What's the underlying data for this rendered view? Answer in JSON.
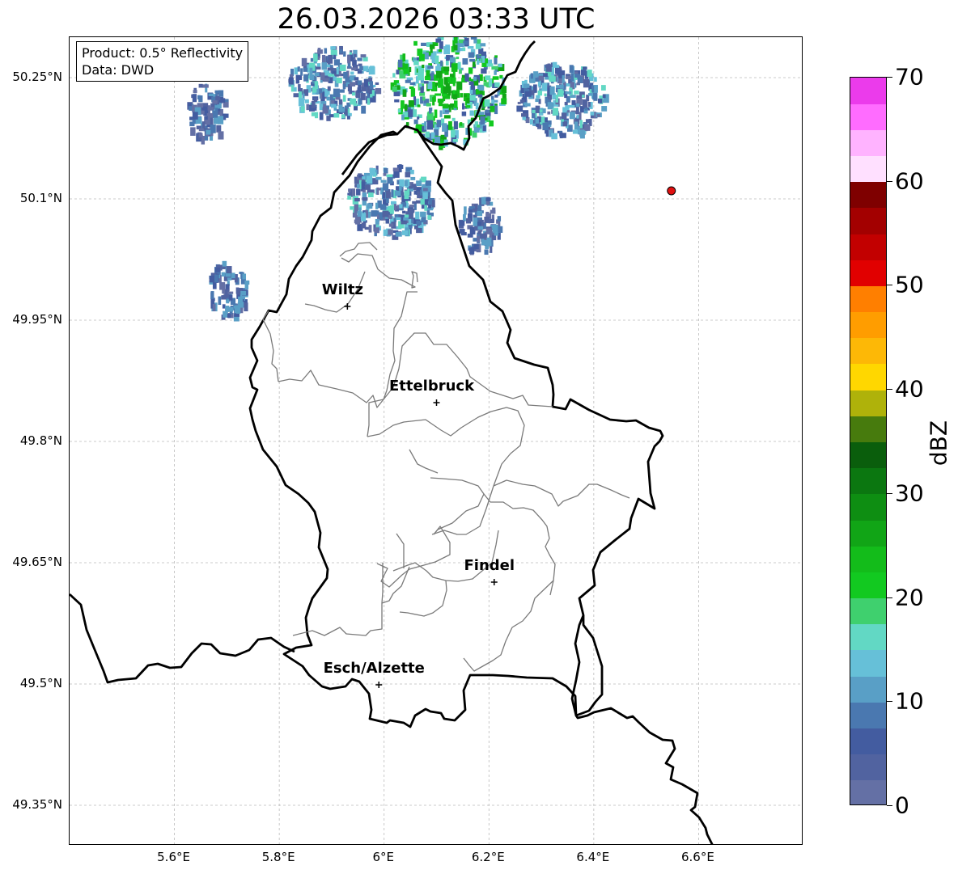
{
  "title": "26.03.2026 03:33 UTC",
  "infobox": {
    "product": "Product: 0.5° Reflectivity",
    "data": "Data: DWD"
  },
  "lat_ticks": [
    {
      "value": 50.25,
      "label": "50.25°N"
    },
    {
      "value": 50.1,
      "label": "50.1°N"
    },
    {
      "value": 49.95,
      "label": "49.95°N"
    },
    {
      "value": 49.8,
      "label": "49.8°N"
    },
    {
      "value": 49.65,
      "label": "49.65°N"
    },
    {
      "value": 49.5,
      "label": "49.5°N"
    },
    {
      "value": 49.35,
      "label": "49.35°N"
    }
  ],
  "lon_ticks": [
    {
      "value": 5.6,
      "label": "5.6°E"
    },
    {
      "value": 5.8,
      "label": "5.8°E"
    },
    {
      "value": 6.0,
      "label": "6°E"
    },
    {
      "value": 6.2,
      "label": "6.2°E"
    },
    {
      "value": 6.4,
      "label": "6.4°E"
    },
    {
      "value": 6.6,
      "label": "6.6°E"
    }
  ],
  "extent": {
    "lon_min": 5.4,
    "lon_max": 6.8,
    "lat_min": 49.3,
    "lat_max": 50.3
  },
  "cities": [
    {
      "name": "Wiltz",
      "lon": 5.93,
      "lat": 49.967
    },
    {
      "name": "Ettelbruck",
      "lon": 6.1,
      "lat": 49.848
    },
    {
      "name": "Findel",
      "lon": 6.21,
      "lat": 49.626
    },
    {
      "name": "Esch/Alzette",
      "lon": 5.99,
      "lat": 49.499
    }
  ],
  "radar_site": {
    "lon": 6.548,
    "lat": 50.11,
    "color": "#e01010"
  },
  "colorbar": {
    "label": "dBZ",
    "min": 0,
    "max": 70,
    "tick_labels": [
      "0",
      "10",
      "20",
      "30",
      "40",
      "50",
      "60",
      "70"
    ],
    "colors": [
      "#6470a5",
      "#5163a0",
      "#435ca0",
      "#4a78b0",
      "#599fc6",
      "#66c0d8",
      "#62d8c4",
      "#3fd06e",
      "#12c920",
      "#13bc1a",
      "#11a516",
      "#0e8e12",
      "#0b7710",
      "#0a5e0c",
      "#477b0d",
      "#afb20a",
      "#ffd700",
      "#fdb806",
      "#ff9d00",
      "#ff7f00",
      "#e10000",
      "#c20000",
      "#a30000",
      "#7f0000",
      "#ffe0ff",
      "#ffb3ff",
      "#ff6cff",
      "#eb3beb"
    ]
  },
  "echoes": [
    {
      "lon": 6.12,
      "lat": 50.24,
      "level": "high"
    },
    {
      "lon": 6.335,
      "lat": 50.225,
      "level": "mid"
    },
    {
      "lon": 5.9,
      "lat": 50.245,
      "level": "mid"
    },
    {
      "lon": 6.01,
      "lat": 50.1,
      "level": "mid"
    },
    {
      "lon": 5.7,
      "lat": 49.99,
      "level": "low"
    },
    {
      "lon": 5.66,
      "lat": 50.21,
      "level": "low"
    },
    {
      "lon": 6.18,
      "lat": 50.07,
      "level": "low"
    }
  ]
}
